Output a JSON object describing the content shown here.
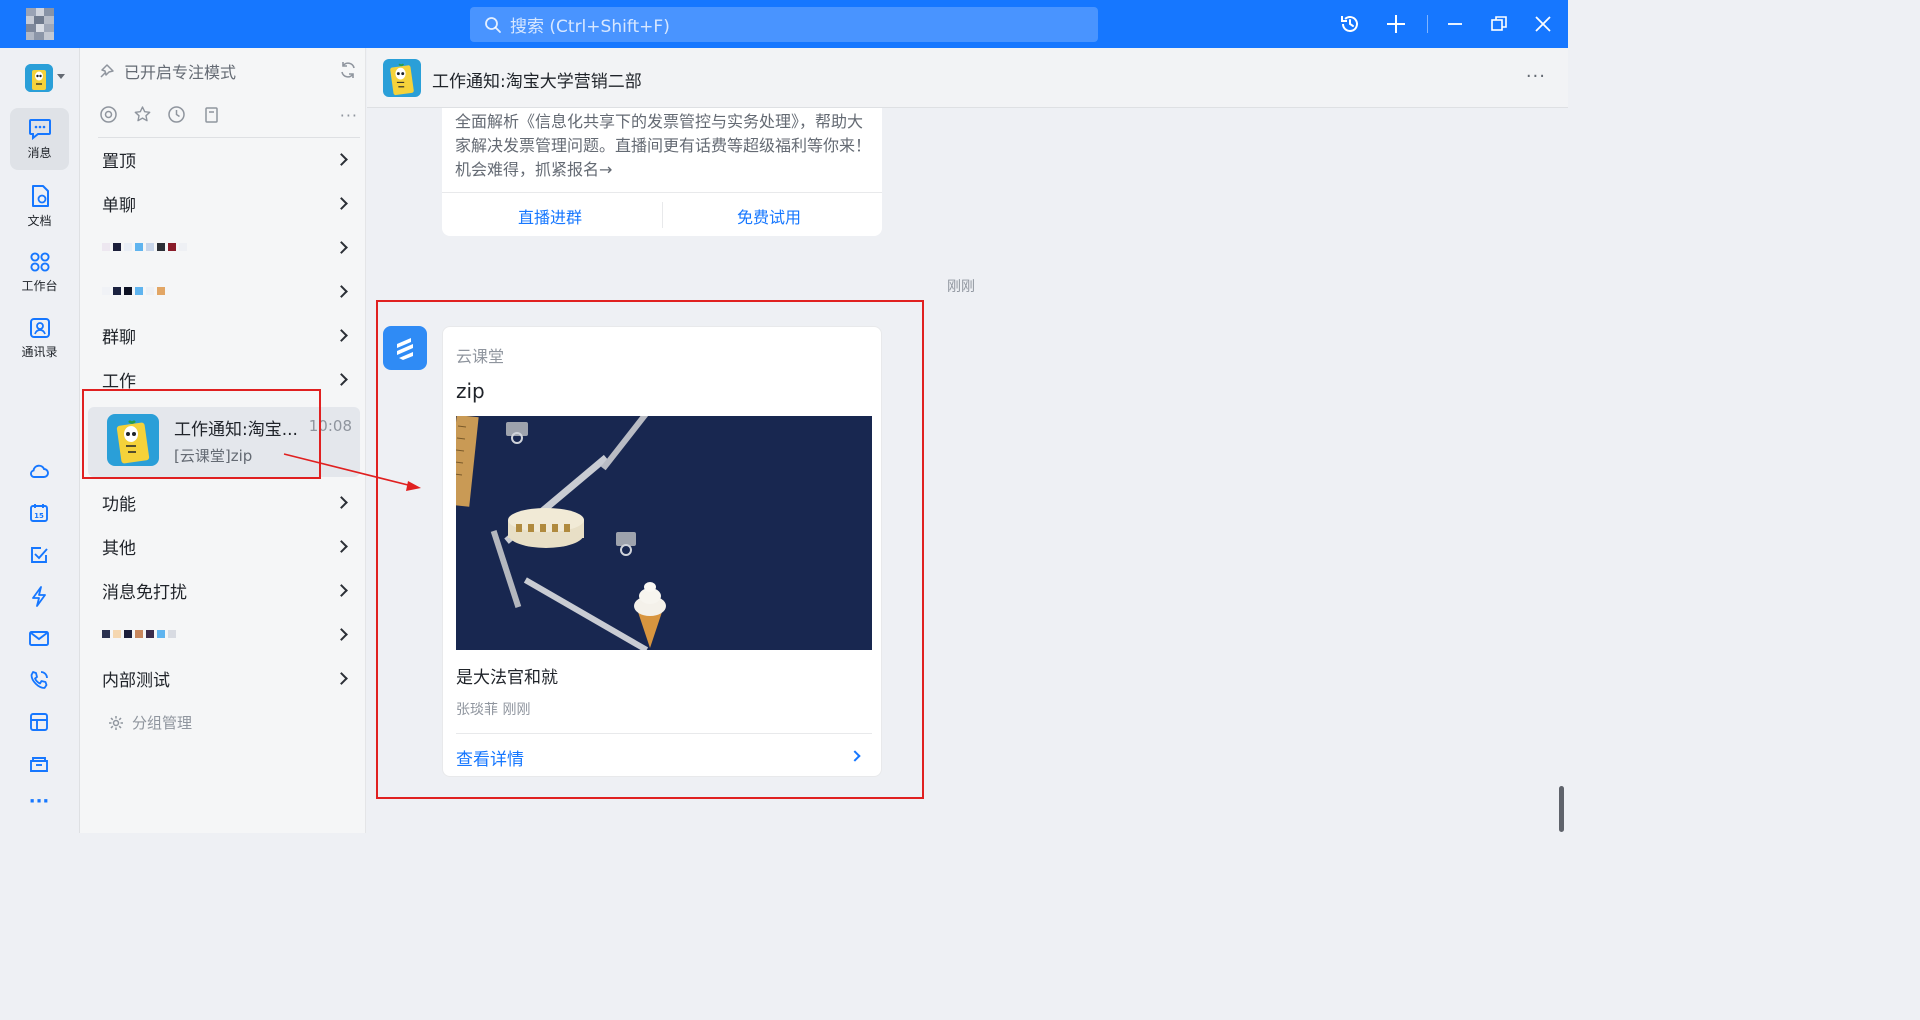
{
  "topbar": {
    "search_placeholder": "搜索 (Ctrl+Shift+F)"
  },
  "rail": {
    "items": [
      {
        "label": "消息",
        "icon": "message-icon",
        "active": true
      },
      {
        "label": "文档",
        "icon": "document-icon"
      },
      {
        "label": "工作台",
        "icon": "workbench-icon"
      },
      {
        "label": "通讯录",
        "icon": "contacts-icon"
      }
    ],
    "more": "···"
  },
  "convlist": {
    "focus_mode": "已开启专注模式",
    "more": "···",
    "groups": {
      "pinned": "置顶",
      "single": "单聊",
      "group": "群聊",
      "work": "工作",
      "function": "功能",
      "other": "其他",
      "mute": "消息免打扰",
      "internal": "内部测试"
    },
    "selected": {
      "title": "工作通知:淘宝...",
      "subtitle": "[云课堂]zip",
      "time": "10:08"
    },
    "manage": "分组管理"
  },
  "chat": {
    "title": "工作通知:淘宝大学营销二部",
    "more": "···",
    "prev_card": {
      "description": "全面解析《信息化共享下的发票管控与实务处理》，帮助大家解决发票管理问题。直播间更有话费等超级福利等你来！机会难得，抓紧报名→",
      "btn_left": "直播进群",
      "btn_right": "免费试用"
    },
    "timestamp": "刚刚",
    "card": {
      "source": "云课堂",
      "title": "zip",
      "body": "是大法官和就",
      "meta": "张琰菲 刚刚",
      "action": "查看详情"
    }
  },
  "colors": {
    "brand": "#1677ff",
    "annotation": "#e02020"
  }
}
